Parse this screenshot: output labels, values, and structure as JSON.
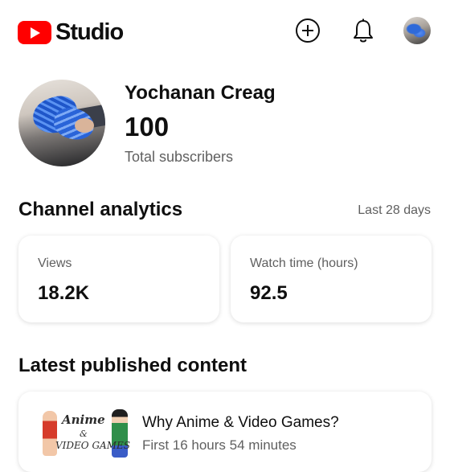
{
  "header": {
    "logo_text": "Studio",
    "icons": {
      "logo": "youtube-play-icon",
      "create": "plus-circle-icon",
      "notifications": "bell-icon",
      "account": "avatar"
    },
    "brand_color": "#ff0000"
  },
  "channel": {
    "name": "Yochanan Creag",
    "subscriber_count": "100",
    "subscriber_label": "Total subscribers"
  },
  "analytics": {
    "title": "Channel analytics",
    "range": "Last 28 days",
    "cards": [
      {
        "label": "Views",
        "value": "18.2K"
      },
      {
        "label": "Watch time (hours)",
        "value": "92.5"
      }
    ]
  },
  "latest": {
    "title": "Latest published content",
    "item": {
      "title": "Why Anime & Video Games?",
      "subtitle": "First 16 hours 54 minutes",
      "thumbnail_text": [
        "Anime",
        "&",
        "VIDEO GAMES"
      ]
    }
  }
}
